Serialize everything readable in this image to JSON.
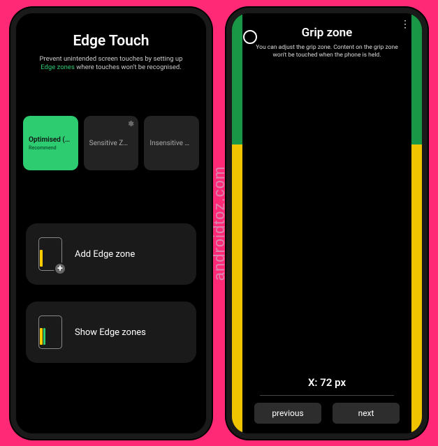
{
  "watermark": "androidtoz.com",
  "left": {
    "title": "Edge Touch",
    "description_pre": "Prevent unintended screen touches by setting up",
    "description_highlight": "Edge zones",
    "description_post": "where touches won't be recognised.",
    "modes": [
      {
        "label": "Optimised (…",
        "sub": "Recommend",
        "active": true
      },
      {
        "label": "Sensitive Z…",
        "active": false,
        "has_gear": true
      },
      {
        "label": "Insensitive …",
        "active": false
      }
    ],
    "actions": {
      "add": "Add Edge zone",
      "show": "Show Edge zones"
    }
  },
  "right": {
    "title": "Grip zone",
    "description": "You can adjust the grip zone. Content on the grip zone won't be touched when the phone is held.",
    "x_label": "X: 72 px",
    "prev": "previous",
    "next": "next"
  }
}
